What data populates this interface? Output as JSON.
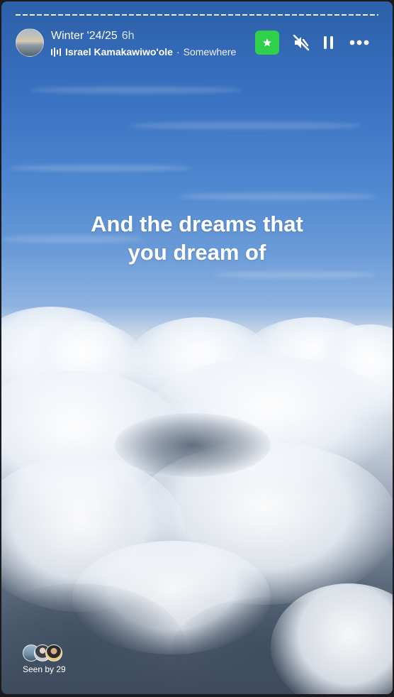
{
  "story": {
    "title": "Winter '24/25",
    "time_ago": "6h",
    "music": {
      "artist": "Israel Kamakawiwo'ole",
      "separator": "·",
      "song": "Somewhere"
    },
    "caption_lines": [
      "And the dreams that",
      "you dream of"
    ],
    "viewers": {
      "seen_by": "Seen by 29"
    }
  },
  "controls": {
    "favorite_icon": "star-icon",
    "mute_icon": "speaker-muted-icon",
    "pause_icon": "pause-icon",
    "more_icon": "more-horizontal-icon",
    "accent": "#2fd04b"
  }
}
